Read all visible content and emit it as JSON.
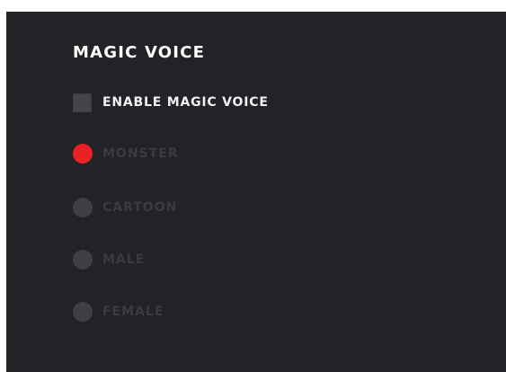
{
  "panel": {
    "title": "MAGIC VOICE",
    "enable": {
      "label": "ENABLE MAGIC VOICE",
      "checked": false
    },
    "options": [
      {
        "label": "MONSTER",
        "selected": true
      },
      {
        "label": "CARTOON",
        "selected": false
      },
      {
        "label": "MALE",
        "selected": false
      },
      {
        "label": "FEMALE",
        "selected": false
      }
    ]
  },
  "colors": {
    "panel_background": "#222326",
    "selected_radio": "#ec2126",
    "unselected_radio": "#3f4044",
    "disabled_text": "#3a3b3f",
    "text": "#f2f2f2"
  }
}
